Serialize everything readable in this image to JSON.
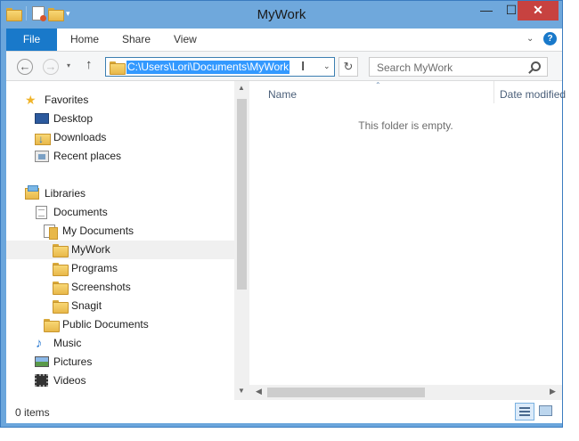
{
  "window": {
    "title": "MyWork",
    "min_glyph": "—",
    "max_glyph": "☐",
    "close_glyph": "✕"
  },
  "quick_access": {
    "dropdown_glyph": "▾"
  },
  "ribbon": {
    "file_tab": "File",
    "home_tab": "Home",
    "share_tab": "Share",
    "view_tab": "View",
    "collapse_glyph": "⌄",
    "help_glyph": "?"
  },
  "nav": {
    "back_glyph": "←",
    "forward_glyph": "→",
    "recent_glyph": "▾",
    "up_glyph": "↑",
    "address_path": "C:\\Users\\Lori\\Documents\\MyWork",
    "address_dropdown_glyph": "⌄",
    "refresh_glyph": "↻",
    "search_placeholder": "Search MyWork"
  },
  "tree": {
    "favorites": "Favorites",
    "desktop": "Desktop",
    "downloads": "Downloads",
    "recent_places": "Recent places",
    "libraries": "Libraries",
    "documents": "Documents",
    "my_documents": "My Documents",
    "mywork": "MyWork",
    "programs": "Programs",
    "screenshots": "Screenshots",
    "snagit": "Snagit",
    "public_documents": "Public Documents",
    "music": "Music",
    "pictures": "Pictures",
    "videos": "Videos"
  },
  "files": {
    "col_name": "Name",
    "col_date": "Date modified",
    "sort_glyph": "⌃",
    "empty_message": "This folder is empty."
  },
  "scroll": {
    "up_glyph": "▲",
    "down_glyph": "▼",
    "left_glyph": "◀",
    "right_glyph": "▶"
  },
  "status": {
    "item_count": "0 items"
  },
  "colors": {
    "titlebar": "#6fa8dc",
    "file_tab": "#1979ca",
    "close_button": "#c74240",
    "selection": "#3399ff"
  }
}
